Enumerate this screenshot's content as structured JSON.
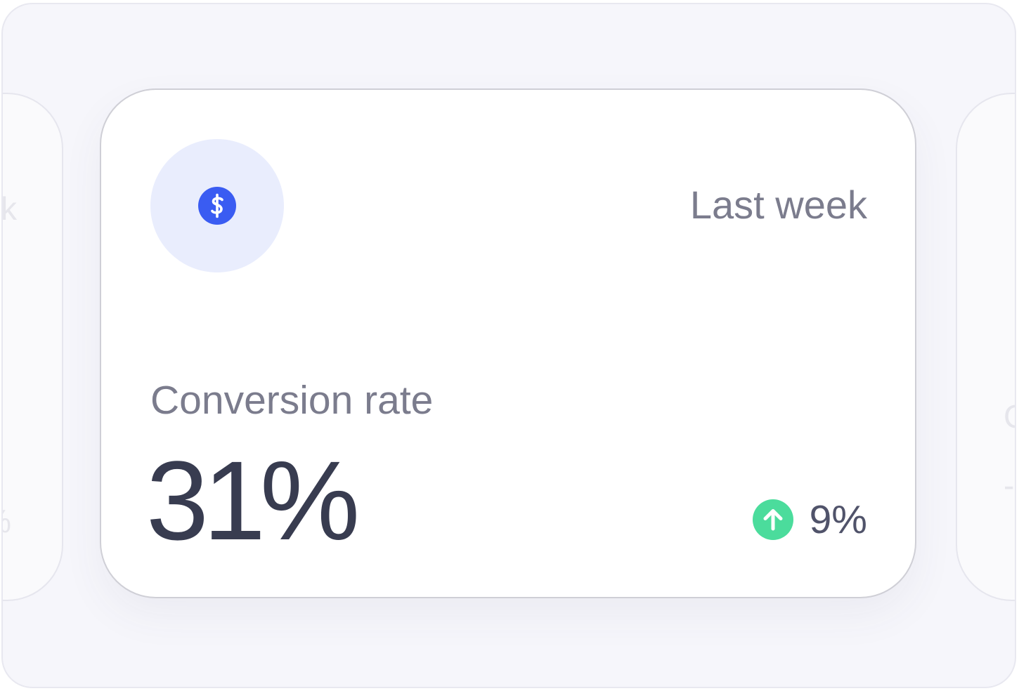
{
  "card": {
    "period": "Last week",
    "metric_label": "Conversion rate",
    "metric_value": "31%",
    "delta_value": "9%",
    "delta_direction": "up",
    "icon": "dollar-icon",
    "delta_icon": "arrow-up-icon"
  },
  "colors": {
    "accent": "#3a5cf2",
    "icon_halo": "#e9edfd",
    "positive": "#4bdc9c",
    "value_text": "#383c50",
    "muted_text": "#7b7c8d"
  }
}
